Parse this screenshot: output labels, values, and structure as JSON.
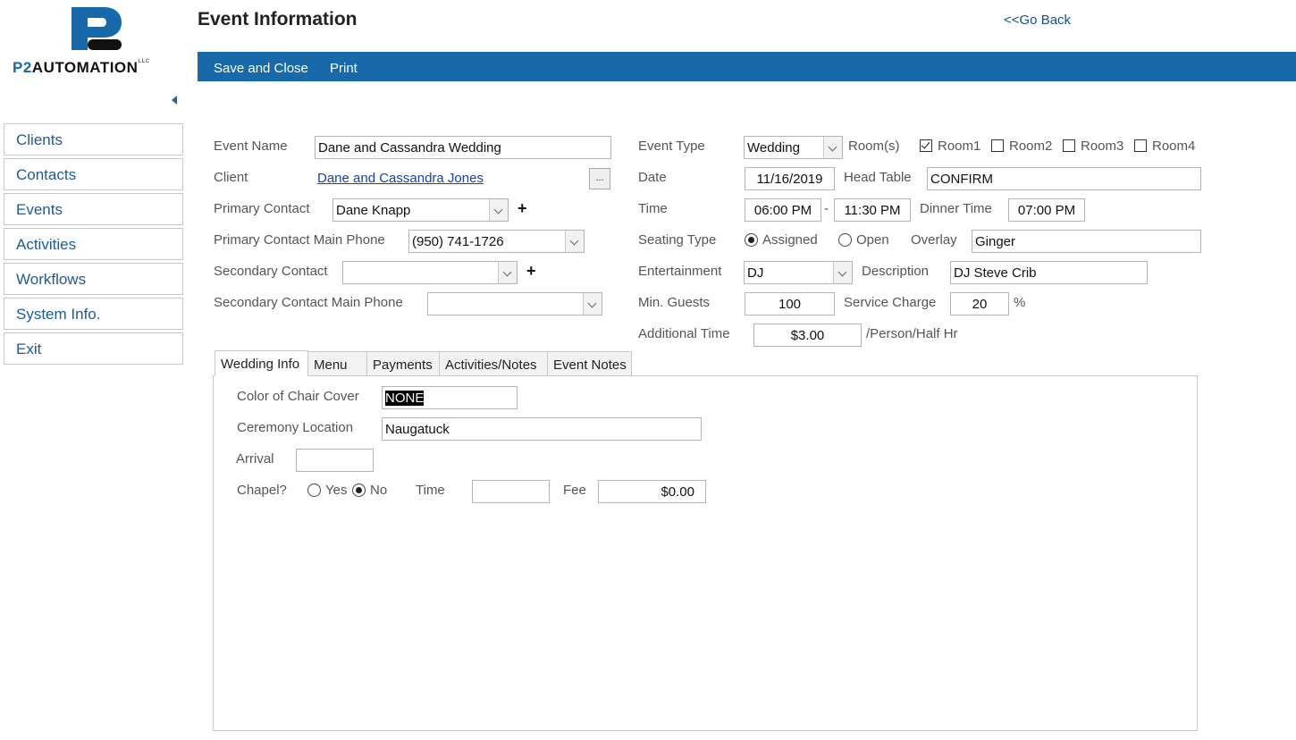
{
  "brand": {
    "logo_text": "P2 AUTOMATION",
    "accent_color": "#1769aa",
    "text_color": "#111111"
  },
  "nav": [
    {
      "label": "Clients"
    },
    {
      "label": "Contacts"
    },
    {
      "label": "Events"
    },
    {
      "label": "Activities"
    },
    {
      "label": "Workflows"
    },
    {
      "label": "System Info."
    },
    {
      "label": "Exit"
    }
  ],
  "header": {
    "title": "Event Information",
    "go_back": "<<Go Back"
  },
  "toolbar": {
    "save_close": "Save and Close",
    "print": "Print",
    "background": "#1769aa"
  },
  "form": {
    "event_name": {
      "label": "Event Name",
      "value": "Dane and Cassandra Wedding"
    },
    "client": {
      "label": "Client",
      "value": "Dane and Cassandra Jones",
      "browse": "..."
    },
    "primary_contact": {
      "label": "Primary Contact",
      "value": "Dane Knapp",
      "add": "+"
    },
    "primary_phone": {
      "label": "Primary Contact Main Phone",
      "value": "(950) 741-1726"
    },
    "secondary_contact": {
      "label": "Secondary Contact",
      "value": "",
      "add": "+"
    },
    "secondary_phone": {
      "label": "Secondary Contact Main Phone",
      "value": ""
    },
    "event_type": {
      "label": "Event Type",
      "value": "Wedding"
    },
    "rooms": {
      "label": "Room(s)",
      "items": [
        {
          "label": "Room1",
          "checked": true
        },
        {
          "label": "Room2",
          "checked": false
        },
        {
          "label": "Room3",
          "checked": false
        },
        {
          "label": "Room4",
          "checked": false
        }
      ]
    },
    "date": {
      "label": "Date",
      "value": "11/16/2019"
    },
    "head_table": {
      "label": "Head Table",
      "value": "CONFIRM"
    },
    "time": {
      "label": "Time",
      "start": "06:00 PM",
      "separator": "-",
      "end": "11:30 PM"
    },
    "dinner_time": {
      "label": "Dinner Time",
      "value": "07:00 PM"
    },
    "seating_type": {
      "label": "Seating Type",
      "options": [
        "Assigned",
        "Open"
      ],
      "selected": "Assigned"
    },
    "overlay": {
      "label": "Overlay",
      "value": "Ginger"
    },
    "entertainment": {
      "label": "Entertainment",
      "value": "DJ"
    },
    "description": {
      "label": "Description",
      "value": "DJ Steve Crib"
    },
    "min_guests": {
      "label": "Min. Guests",
      "value": "100"
    },
    "service_charge": {
      "label": "Service Charge",
      "value": "20",
      "unit": "%"
    },
    "additional_time": {
      "label": "Additional Time",
      "value": "$3.00",
      "unit": "/Person/Half Hr"
    }
  },
  "tabs": [
    {
      "label": "Wedding Info",
      "active": true
    },
    {
      "label": "Menu",
      "active": false
    },
    {
      "label": "Payments",
      "active": false
    },
    {
      "label": "Activities/Notes",
      "active": false
    },
    {
      "label": "Event Notes",
      "active": false
    }
  ],
  "wedding_info": {
    "chair_cover": {
      "label": "Color of Chair Cover",
      "value": "NONE"
    },
    "ceremony_location": {
      "label": "Ceremony Location",
      "value": "Naugatuck"
    },
    "arrival": {
      "label": "Arrival",
      "value": ""
    },
    "chapel": {
      "label": "Chapel?",
      "options": [
        "Yes",
        "No"
      ],
      "selected": "No"
    },
    "time": {
      "label": "Time",
      "value": ""
    },
    "fee": {
      "label": "Fee",
      "value": "$0.00"
    }
  }
}
